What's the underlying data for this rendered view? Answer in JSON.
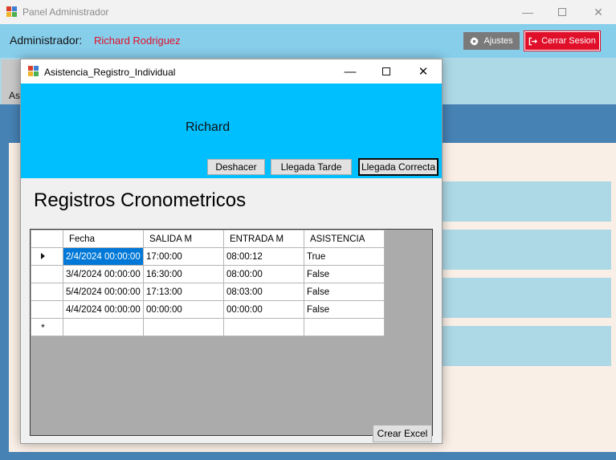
{
  "main_window": {
    "title": "Panel Administrador",
    "min_label": "—",
    "close_label": "✕",
    "admin_label": "Administrador:",
    "admin_name": "Richard Rodriguez",
    "settings_button": "Ajustes",
    "logout_button": "Cerrar Sesion",
    "tab_fragment": "As"
  },
  "dialog": {
    "title": "Asistencia_Registro_Individual",
    "min_label": "—",
    "close_label": "✕",
    "student_name": "Richard",
    "buttons": {
      "undo": "Deshacer",
      "late": "Llegada Tarde",
      "correct": "Llegada Correcta",
      "excel": "Crear Excel"
    },
    "section_title": "Registros Cronometricos",
    "grid": {
      "columns": [
        "Fecha",
        "SALIDA M",
        "ENTRADA M",
        "ASISTENCIA"
      ],
      "rows": [
        [
          "2/4/2024 00:00:00",
          "17:00:00",
          "08:00:12",
          "True"
        ],
        [
          "3/4/2024 00:00:00",
          "16:30:00",
          "08:00:00",
          "False"
        ],
        [
          "5/4/2024 00:00:00",
          "17:13:00",
          "08:03:00",
          "False"
        ],
        [
          "4/4/2024 00:00:00",
          "00:00:00",
          "00:00:00",
          "False"
        ]
      ],
      "new_row_marker": "*"
    }
  },
  "colors": {
    "header_bar": "#87ceeb",
    "banner": "#00bfff",
    "danger": "#e0102a",
    "selection": "#0078d7",
    "content_frame": "#4682b4"
  }
}
